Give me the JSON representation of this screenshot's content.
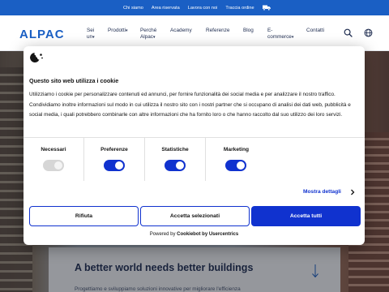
{
  "topbar": {
    "links": [
      "Chi siamo",
      "Area riservata",
      "Lavora con noi",
      "Traccia ordine"
    ]
  },
  "nav": {
    "logo": "ALPAC",
    "items": [
      {
        "label": "Sei un",
        "has_caret": true
      },
      {
        "label": "Prodotti",
        "has_caret": true
      },
      {
        "label": "Perché Alpac",
        "has_caret": true
      },
      {
        "label": "Academy"
      },
      {
        "label": "Referenze"
      },
      {
        "label": "Blog"
      },
      {
        "label": "E-commerce",
        "has_caret": true
      },
      {
        "label": "Contatti"
      }
    ],
    "icons": [
      "search-icon",
      "globe-icon"
    ]
  },
  "hero": {
    "title": "A better world needs better buildings",
    "text": "Progettiamo e sviluppiamo soluzioni innovative per migliorare l'efficienza"
  },
  "cookie": {
    "title": "Questo sito web utilizza i cookie",
    "text": "Utilizziamo i cookie per personalizzare contenuti ed annunci, per fornire funzionalità dei social media e per analizzare il nostro traffico. Condividiamo inoltre informazioni sul modo in cui utilizza il nostro sito con i nostri partner che si occupano di analisi dei dati web, pubblicità e social media, i quali potrebbero combinarle con altre informazioni che ha fornito loro o che hanno raccolto dal suo utilizzo dei loro servizi.",
    "categories": [
      {
        "label": "Necessari",
        "enabled": true,
        "locked": true
      },
      {
        "label": "Preferenze",
        "enabled": true
      },
      {
        "label": "Statistiche",
        "enabled": true
      },
      {
        "label": "Marketing",
        "enabled": true
      }
    ],
    "details_link": "Mostra dettagli",
    "buttons": {
      "deny": "Rifiuta",
      "accept_selected": "Accetta selezionati",
      "accept_all": "Accetta tutti"
    },
    "powered_prefix": "Powered by",
    "powered_brand": "Cookiebot by Usercentrics"
  },
  "colors": {
    "brand_blue": "#1a5fc4",
    "cookie_blue": "#1032cf",
    "text_dark": "#141414"
  }
}
